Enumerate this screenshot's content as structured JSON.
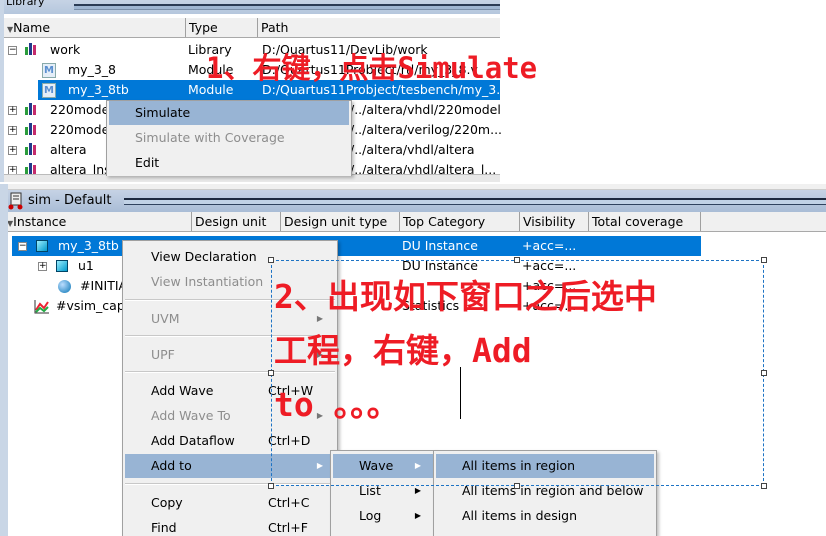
{
  "library": {
    "title": "Library",
    "columns": [
      "Name",
      "Type",
      "Path"
    ],
    "rows": [
      {
        "name": "work",
        "type": "Library",
        "path": "D:/Quartus11/DevLib/work",
        "kind": "library",
        "expander": "−"
      },
      {
        "name": "my_3_8",
        "type": "Module",
        "path": "D:/Quartus11Probject/rtl/my_3_8.v",
        "kind": "module"
      },
      {
        "name": "my_3_8tb",
        "type": "Module",
        "path": "D:/Quartus11Probject/tesbench/my_3..",
        "kind": "module",
        "selected": true
      },
      {
        "name": "220model",
        "type": "",
        "path": "/../altera/vhdl/220model",
        "kind": "library",
        "expander": "+"
      },
      {
        "name": "220model",
        "type": "",
        "path": "/../altera/verilog/220m...",
        "kind": "library",
        "expander": "+"
      },
      {
        "name": "altera",
        "type": "",
        "path": "/../altera/vhdl/altera",
        "kind": "library",
        "expander": "+"
      },
      {
        "name": "altera_lns",
        "type": "",
        "path": "/../altera/vhdl/altera_l...",
        "kind": "library",
        "expander": "+"
      }
    ],
    "module_icon_letter": "M"
  },
  "library_context_menu": {
    "items": [
      {
        "label": "Simulate",
        "highlighted": true
      },
      {
        "label": "Simulate with Coverage",
        "disabled": true
      },
      {
        "label": "Edit"
      }
    ]
  },
  "sim": {
    "title": "sim - Default",
    "columns": [
      "Instance",
      "Design unit",
      "Design unit type",
      "Top Category",
      "Visibility",
      "Total coverage"
    ],
    "rows": [
      {
        "instance": "my_3_8tb",
        "top_category": "DU Instance",
        "visibility": "+acc=...",
        "selected": true,
        "expander": "−"
      },
      {
        "instance": "u1",
        "top_category": "DU Instance",
        "visibility": "+acc=...",
        "expander": "+"
      },
      {
        "instance": "#INITIAL",
        "top_category": "",
        "visibility": "+acc=..."
      },
      {
        "instance": "#vsim_capacity",
        "top_category": "Statistics",
        "visibility": "+acc=..."
      }
    ]
  },
  "sim_context_menu": {
    "items": [
      {
        "label": "View Declaration"
      },
      {
        "label": "View Instantiation",
        "disabled": true
      },
      {
        "label": "UVM",
        "disabled": true
      },
      {
        "label": "UPF",
        "disabled": true
      },
      {
        "label": "Add Wave",
        "shortcut": "Ctrl+W"
      },
      {
        "label": "Add Wave To",
        "disabled": true,
        "submenu": true
      },
      {
        "label": "Add Dataflow",
        "shortcut": "Ctrl+D"
      },
      {
        "label": "Add to",
        "highlighted": true,
        "submenu": true
      },
      {
        "label": "Copy",
        "shortcut": "Ctrl+C"
      },
      {
        "label": "Find",
        "shortcut": "Ctrl+F"
      }
    ]
  },
  "add_to_submenu": {
    "items": [
      {
        "label": "Wave",
        "highlighted": true,
        "submenu": true
      },
      {
        "label": "List",
        "submenu": true
      },
      {
        "label": "Log",
        "submenu": true
      }
    ]
  },
  "wave_submenu": {
    "items": [
      {
        "label": "All items in region",
        "highlighted": true
      },
      {
        "label": "All items in region and below"
      },
      {
        "label": "All items in design"
      }
    ]
  },
  "annotations": {
    "step1": "1、右键，点击Simulate",
    "step2_line1": "2、出现如下窗口之后选中",
    "step2_line2": "工程，右键，Add",
    "step2_line3": "to 。。。",
    "color": "#ee1c25"
  }
}
